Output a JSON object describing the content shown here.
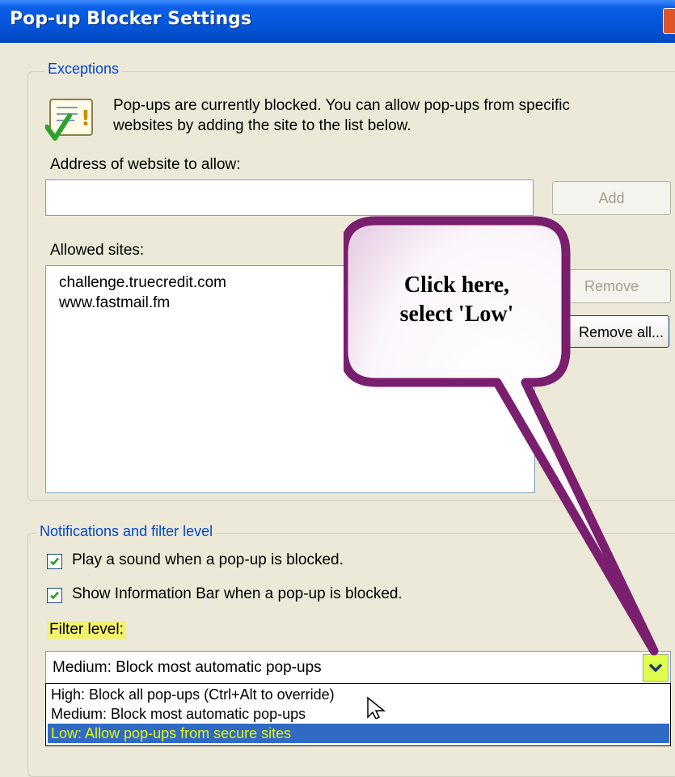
{
  "window": {
    "title": "Pop-up Blocker Settings"
  },
  "exceptions": {
    "legend": "Exceptions",
    "info_line1": "Pop-ups are currently blocked.  You can allow pop-ups from specific",
    "info_line2": "websites by adding the site to the list below.",
    "address_label": "Address of website to allow:",
    "address_value": "",
    "add_label": "Add",
    "allowed_label": "Allowed sites:",
    "allowed_sites": [
      "challenge.truecredit.com",
      "www.fastmail.fm"
    ],
    "remove_label": "Remove",
    "remove_all_label": "Remove all..."
  },
  "notifications": {
    "legend": "Notifications and filter level",
    "play_sound_label": "Play a sound when a pop-up is blocked.",
    "play_sound_checked": true,
    "info_bar_label": "Show Information Bar when a pop-up is blocked.",
    "info_bar_checked": true,
    "filter_label": "Filter level:",
    "filter_selected": "Medium: Block most automatic pop-ups",
    "filter_options": [
      "High: Block all pop-ups (Ctrl+Alt to override)",
      "Medium: Block most automatic pop-ups",
      "Low: Allow pop-ups from secure sites"
    ],
    "highlighted_option": 2
  },
  "callout": {
    "line1": "Click here,",
    "line2": "select 'Low'"
  },
  "colors": {
    "accent": "#0046d5",
    "callout_border": "#7a1e6e",
    "highlight": "#f3f36b",
    "selection": "#316ac5"
  },
  "icons": {
    "info": "checklist-warning-icon",
    "dropdown": "chevron-down-icon",
    "checkbox": "check-icon",
    "cursor": "mouse-pointer-icon"
  }
}
